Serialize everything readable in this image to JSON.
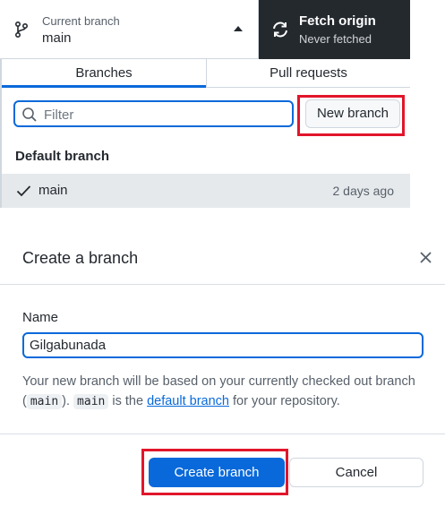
{
  "toolbar": {
    "branch": {
      "label": "Current branch",
      "value": "main",
      "icon": "git-branch-icon"
    },
    "fetch": {
      "title": "Fetch origin",
      "status": "Never fetched",
      "icon": "sync-icon"
    }
  },
  "branches_panel": {
    "tabs": [
      {
        "label": "Branches",
        "active": true
      },
      {
        "label": "Pull requests",
        "active": false
      }
    ],
    "filter_placeholder": "Filter",
    "new_branch_label": "New branch",
    "section_label": "Default branch",
    "rows": [
      {
        "name": "main",
        "time": "2 days ago",
        "selected": true
      }
    ]
  },
  "dialog": {
    "title": "Create a branch",
    "name_label": "Name",
    "name_value": "Gilgabunada",
    "help_text_1": "Your new branch will be based on your currently checked out branch (",
    "help_code_1": "main",
    "help_text_2": "). ",
    "help_code_2": "main",
    "help_text_3": " is the ",
    "help_link": "default branch",
    "help_text_4": " for your repository.",
    "create_label": "Create branch",
    "cancel_label": "Cancel"
  },
  "colors": {
    "accent": "#0969da",
    "highlight": "#e1162b",
    "toolbar_dark": "#24292e"
  }
}
